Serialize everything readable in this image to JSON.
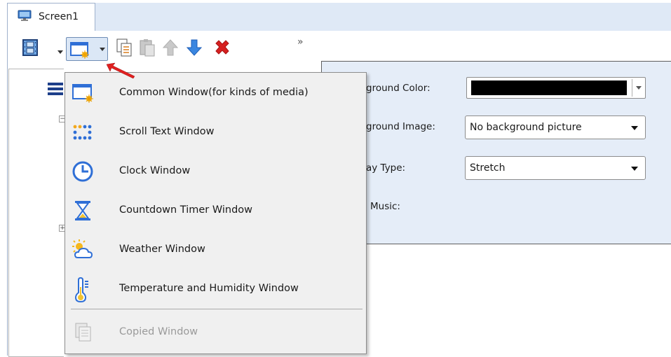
{
  "tab": {
    "label": "Screen1",
    "icon": "monitor-icon"
  },
  "toolbar": {
    "items": [
      {
        "name": "film-strip-icon"
      },
      {
        "name": "new-window-icon"
      },
      {
        "name": "copy-icon"
      },
      {
        "name": "paste-icon"
      },
      {
        "name": "move-up-icon"
      },
      {
        "name": "move-down-icon"
      },
      {
        "name": "delete-icon"
      }
    ],
    "overflow": "»"
  },
  "properties": {
    "background_color_label": "ground Color:",
    "background_color_value": "#000000",
    "background_image_label": "ground Image:",
    "background_image_value": "No background picture",
    "display_type_label": "ay Type:",
    "display_type_value": "Stretch",
    "music_label": "Music:"
  },
  "menu": {
    "items": [
      {
        "label": "Common Window(for kinds of media)",
        "icon": "common-window-icon",
        "enabled": true
      },
      {
        "label": "Scroll Text Window",
        "icon": "scroll-text-icon",
        "enabled": true
      },
      {
        "label": "Clock Window",
        "icon": "clock-icon",
        "enabled": true
      },
      {
        "label": "Countdown Timer Window",
        "icon": "hourglass-icon",
        "enabled": true
      },
      {
        "label": "Weather Window",
        "icon": "weather-icon",
        "enabled": true
      },
      {
        "label": "Temperature and Humidity Window",
        "icon": "thermometer-icon",
        "enabled": true
      },
      {
        "label": "Copied Window",
        "icon": "copied-window-icon",
        "enabled": false
      }
    ]
  },
  "colors": {
    "accent_blue": "#2f6fd6",
    "delete_red": "#d62020",
    "pointer_red": "#e02020",
    "panel_bg": "#e5edf8"
  }
}
